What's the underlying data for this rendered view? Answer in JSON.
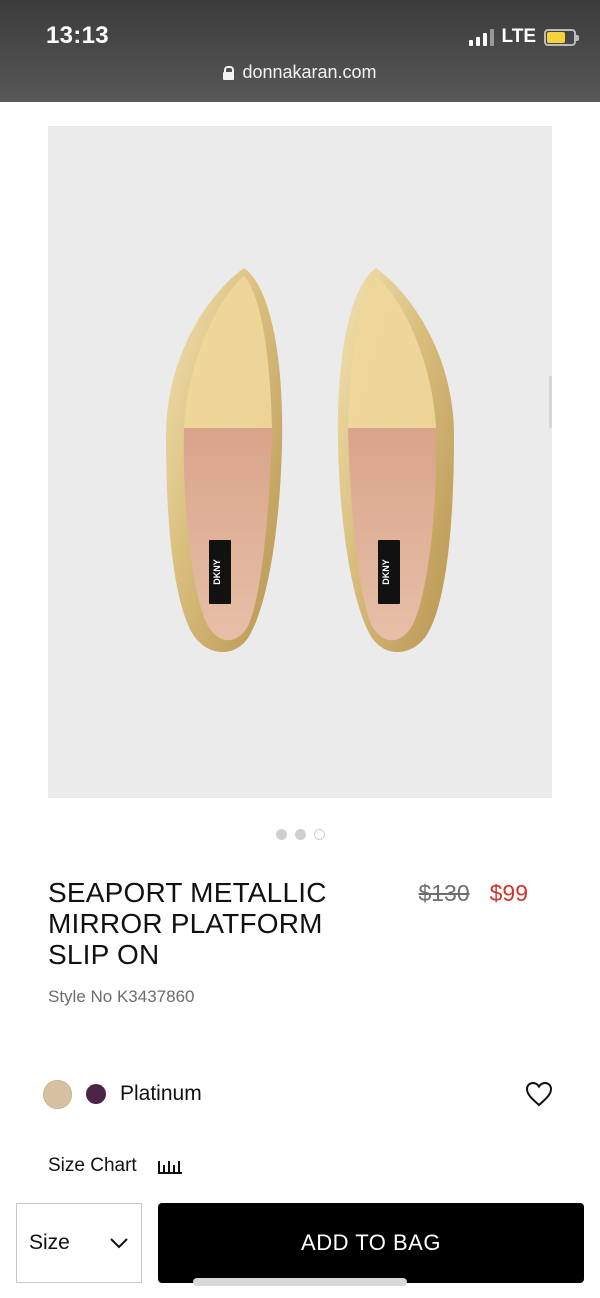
{
  "status_bar": {
    "time": "13:13",
    "network": "LTE",
    "url": "donnakaran.com",
    "battery_level": 0.7
  },
  "product": {
    "image_brand_label": "DKNY",
    "title": "SEAPORT METALLIC MIRROR PLATFORM SLIP ON",
    "price_original": "$130",
    "price_sale": "$99",
    "style_no": "Style No K3437860",
    "carousel": {
      "count": 3,
      "active_index": 0
    }
  },
  "colors": {
    "selected_name": "Platinum",
    "swatches": [
      "#d6c2a2",
      "#4b2447"
    ]
  },
  "size_chart": {
    "label": "Size Chart"
  },
  "size_select": {
    "value": "Size"
  },
  "actions": {
    "add_to_bag": "ADD TO BAG"
  },
  "theme": {
    "sale_color": "#d0342c",
    "button_color": "#000000"
  }
}
